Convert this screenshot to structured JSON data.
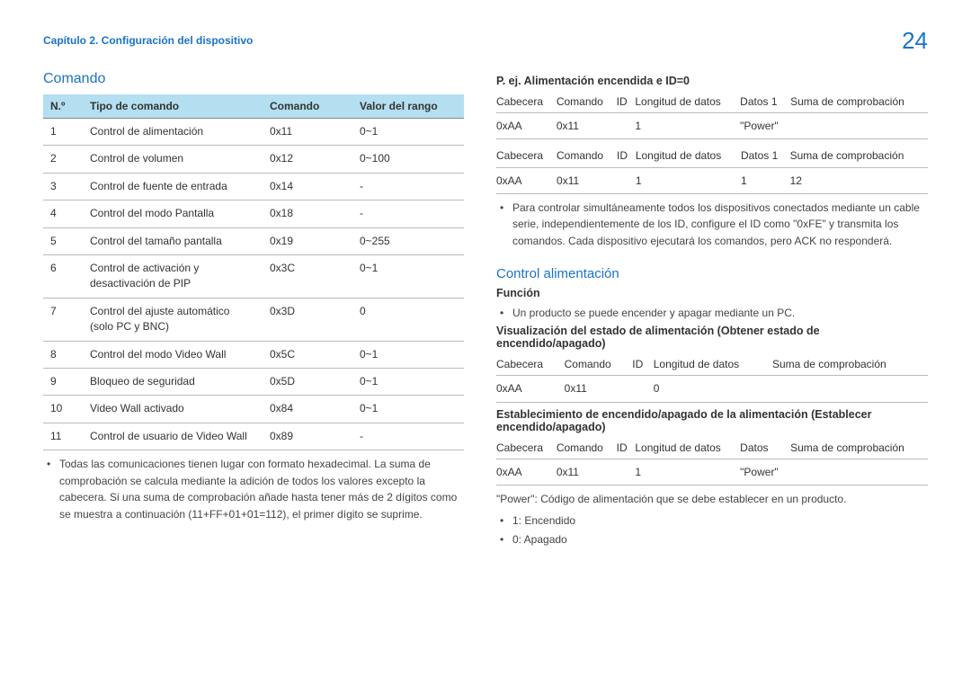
{
  "header": {
    "chapter": "Capítulo 2. Configuración del dispositivo",
    "page": "24"
  },
  "left": {
    "title": "Comando",
    "table_headers": {
      "n": "N.º",
      "tipo": "Tipo de comando",
      "comando": "Comando",
      "valor": "Valor del rango"
    },
    "rows": [
      {
        "n": "1",
        "tipo": "Control de alimentación",
        "comando": "0x11",
        "valor": "0~1"
      },
      {
        "n": "2",
        "tipo": "Control de volumen",
        "comando": "0x12",
        "valor": "0~100"
      },
      {
        "n": "3",
        "tipo": "Control de fuente de entrada",
        "comando": "0x14",
        "valor": "-"
      },
      {
        "n": "4",
        "tipo": "Control del modo Pantalla",
        "comando": "0x18",
        "valor": "-"
      },
      {
        "n": "5",
        "tipo": "Control del tamaño pantalla",
        "comando": "0x19",
        "valor": "0~255"
      },
      {
        "n": "6",
        "tipo": "Control de activación y desactivación de PIP",
        "comando": "0x3C",
        "valor": "0~1"
      },
      {
        "n": "7",
        "tipo": "Control del ajuste automático (solo PC y BNC)",
        "comando": "0x3D",
        "valor": "0"
      },
      {
        "n": "8",
        "tipo": "Control del modo Video Wall",
        "comando": "0x5C",
        "valor": "0~1"
      },
      {
        "n": "9",
        "tipo": "Bloqueo de seguridad",
        "comando": "0x5D",
        "valor": "0~1"
      },
      {
        "n": "10",
        "tipo": "Video Wall activado",
        "comando": "0x84",
        "valor": "0~1"
      },
      {
        "n": "11",
        "tipo": "Control de usuario de Video Wall",
        "comando": "0x89",
        "valor": "-"
      }
    ],
    "note": "Todas las comunicaciones tienen lugar con formato hexadecimal. La suma de comprobación se calcula mediante la adición de todos los valores excepto la cabecera. Si una suma de comprobación añade hasta tener más de 2 dígitos como se muestra a continuación (11+FF+01+01=112), el primer dígito se suprime."
  },
  "right": {
    "example_title": "P. ej. Alimentación encendida e ID=0",
    "param_headers": {
      "cabecera": "Cabecera",
      "comando": "Comando",
      "id": "ID",
      "longitud": "Longitud de datos",
      "datos1": "Datos 1",
      "datos": "Datos",
      "suma": "Suma de comprobación"
    },
    "example1": {
      "cabecera": "0xAA",
      "comando": "0x11",
      "id": "",
      "longitud": "1",
      "datos1": "\"Power\"",
      "suma": ""
    },
    "example2": {
      "cabecera": "0xAA",
      "comando": "0x11",
      "id": "",
      "longitud": "1",
      "datos1": "1",
      "suma": "12"
    },
    "example_note": "Para controlar simultáneamente todos los dispositivos conectados mediante un cable serie, independientemente de los ID, configure el ID como \"0xFE\" y transmita los comandos. Cada dispositivo ejecutará los comandos, pero ACK no responderá.",
    "control_title": "Control alimentación",
    "function_title": "Función",
    "function_bullet": "Un producto se puede encender y apagar mediante un PC.",
    "view_title": "Visualización del estado de alimentación (Obtener estado de encendido/apagado)",
    "view_row": {
      "cabecera": "0xAA",
      "comando": "0x11",
      "id": "",
      "longitud": "0",
      "suma": ""
    },
    "set_title": "Establecimiento de encendido/apagado de la alimentación (Establecer encendido/apagado)",
    "set_row": {
      "cabecera": "0xAA",
      "comando": "0x11",
      "id": "",
      "longitud": "1",
      "datos": "\"Power\"",
      "suma": ""
    },
    "power_note": "\"Power\": Código de alimentación que se debe establecer en un producto.",
    "power_vals": [
      "1: Encendido",
      "0: Apagado"
    ]
  }
}
